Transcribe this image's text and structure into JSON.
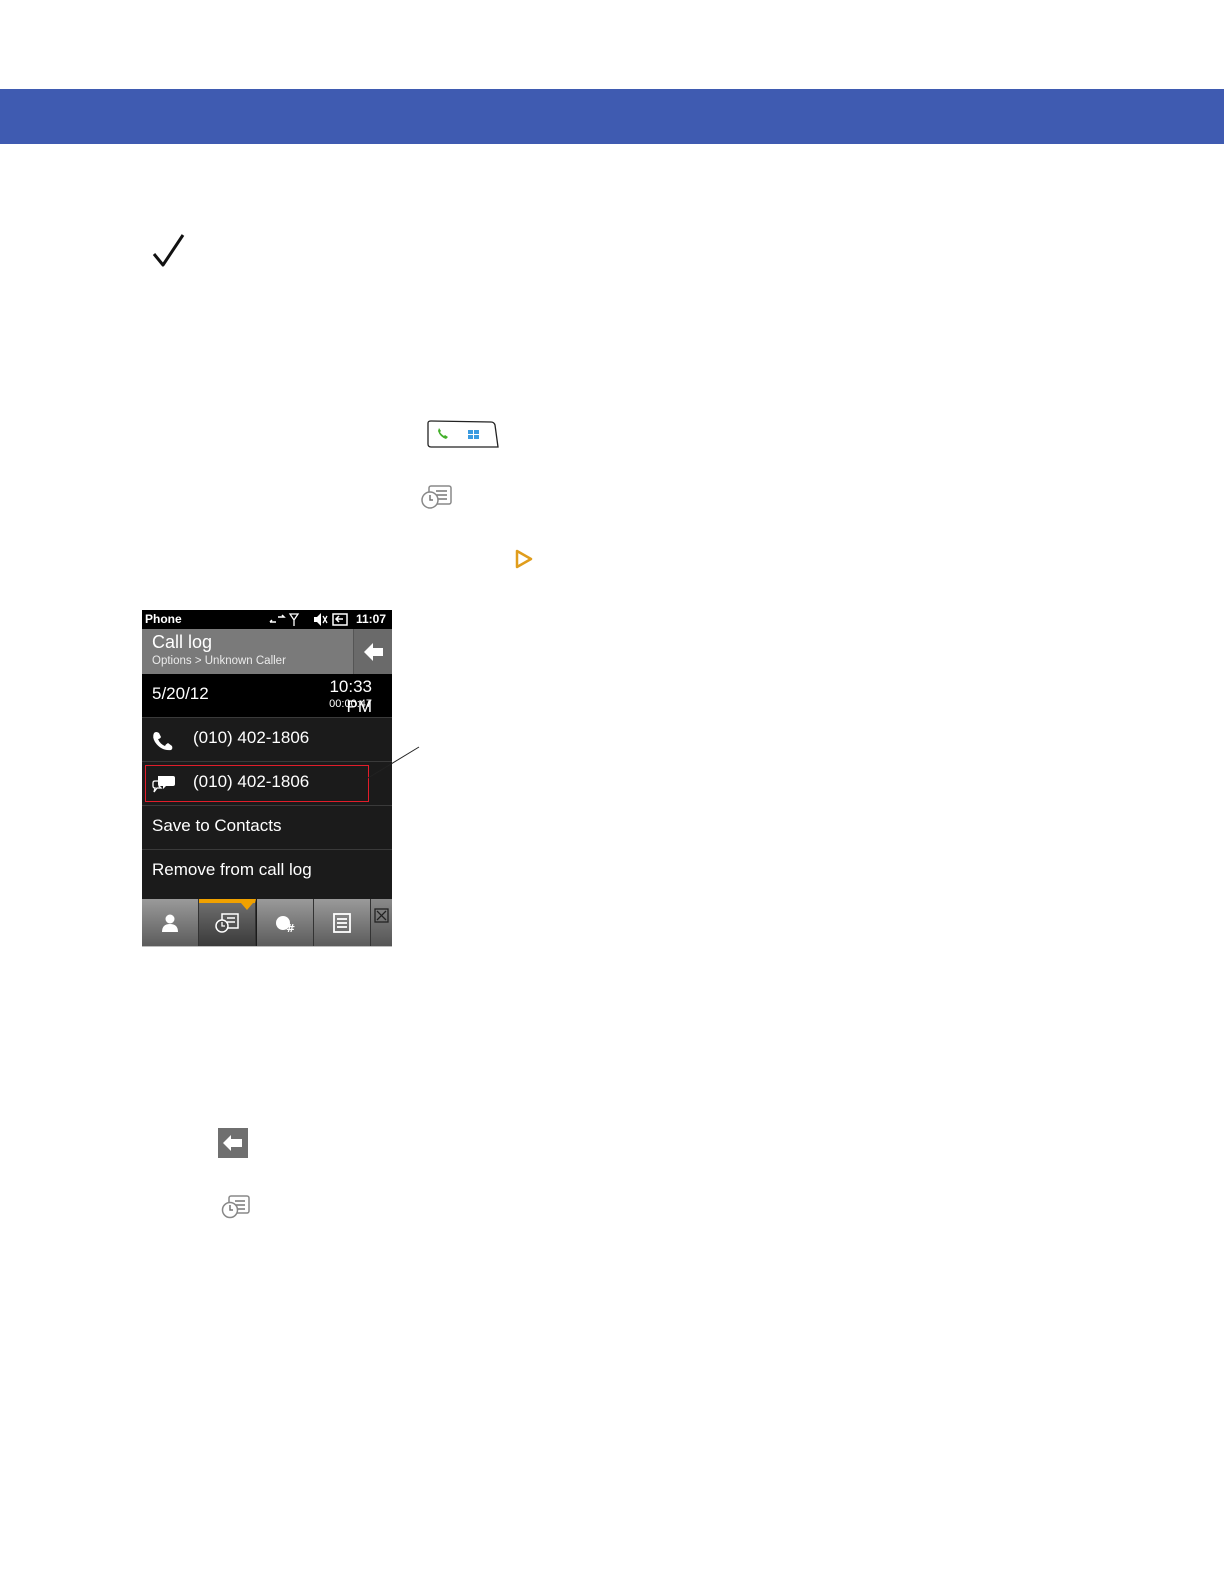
{
  "colors": {
    "header_band": "#3f5bb1",
    "highlight": "#e11d2a",
    "active_tab": "#f0a100"
  },
  "icons": [
    "check-mark-icon",
    "start-key-icon",
    "call-log-icon",
    "play-arrow-icon",
    "back-arrow-icon"
  ],
  "phone": {
    "status": {
      "app": "Phone",
      "time": "11:07"
    },
    "title": "Call log",
    "breadcrumb": "Options > Unknown Caller",
    "date": "5/20/12",
    "time": "10:33 PM",
    "duration": "00:00:47",
    "rows": [
      {
        "label": "(010) 402-1806",
        "icon": "phone-handset-icon"
      },
      {
        "label": "(010) 402-1806",
        "icon": "message-bubble-icon"
      },
      {
        "label": "Save to Contacts"
      },
      {
        "label": "Remove from call log"
      }
    ],
    "toolbar": [
      "contacts-icon",
      "call-log-icon",
      "keypad-icon",
      "menu-icon",
      "close-icon"
    ]
  }
}
